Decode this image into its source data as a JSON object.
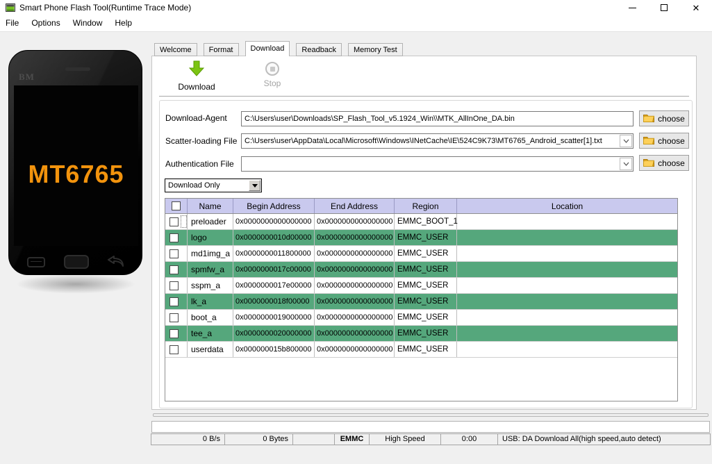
{
  "window": {
    "title": "Smart Phone Flash Tool(Runtime Trace Mode)"
  },
  "menu": {
    "items": [
      "File",
      "Options",
      "Window",
      "Help"
    ]
  },
  "phone": {
    "brand": "BM",
    "chipset": "MT6765"
  },
  "tabs": {
    "items": [
      "Welcome",
      "Format",
      "Download",
      "Readback",
      "Memory Test"
    ],
    "active": "Download"
  },
  "toolbar": {
    "download_label": "Download",
    "stop_label": "Stop"
  },
  "fields": {
    "download_agent": {
      "label": "Download-Agent",
      "value": "C:\\Users\\user\\Downloads\\SP_Flash_Tool_v5.1924_Win\\\\MTK_AllInOne_DA.bin",
      "choose_label": "choose"
    },
    "scatter_file": {
      "label": "Scatter-loading File",
      "value": "C:\\Users\\user\\AppData\\Local\\Microsoft\\Windows\\INetCache\\IE\\524C9K73\\MT6765_Android_scatter[1].txt",
      "choose_label": "choose"
    },
    "auth_file": {
      "label": "Authentication File",
      "value": "",
      "choose_label": "choose"
    }
  },
  "mode_select": {
    "value": "Download Only"
  },
  "table": {
    "headers": [
      "Name",
      "Begin Address",
      "End Address",
      "Region",
      "Location"
    ],
    "rows": [
      {
        "name": "preloader",
        "begin": "0x0000000000000000",
        "end": "0x0000000000000000",
        "region": "EMMC_BOOT_1",
        "location": "",
        "highlight": false,
        "checked": false
      },
      {
        "name": "logo",
        "begin": "0x0000000010d00000",
        "end": "0x0000000000000000",
        "region": "EMMC_USER",
        "location": "",
        "highlight": true,
        "checked": false
      },
      {
        "name": "md1img_a",
        "begin": "0x0000000011800000",
        "end": "0x0000000000000000",
        "region": "EMMC_USER",
        "location": "",
        "highlight": false,
        "checked": false
      },
      {
        "name": "spmfw_a",
        "begin": "0x0000000017c00000",
        "end": "0x0000000000000000",
        "region": "EMMC_USER",
        "location": "",
        "highlight": true,
        "checked": false
      },
      {
        "name": "sspm_a",
        "begin": "0x0000000017e00000",
        "end": "0x0000000000000000",
        "region": "EMMC_USER",
        "location": "",
        "highlight": false,
        "checked": false
      },
      {
        "name": "lk_a",
        "begin": "0x0000000018f00000",
        "end": "0x0000000000000000",
        "region": "EMMC_USER",
        "location": "",
        "highlight": true,
        "checked": false
      },
      {
        "name": "boot_a",
        "begin": "0x0000000019000000",
        "end": "0x0000000000000000",
        "region": "EMMC_USER",
        "location": "",
        "highlight": false,
        "checked": false
      },
      {
        "name": "tee_a",
        "begin": "0x0000000020000000",
        "end": "0x0000000000000000",
        "region": "EMMC_USER",
        "location": "",
        "highlight": true,
        "checked": false
      },
      {
        "name": "userdata",
        "begin": "0x000000015b800000",
        "end": "0x0000000000000000",
        "region": "EMMC_USER",
        "location": "",
        "highlight": false,
        "checked": false
      }
    ]
  },
  "status_bar": {
    "speed": "0 B/s",
    "bytes": "0 Bytes",
    "storage": "EMMC",
    "speed_mode": "High Speed",
    "time": "0:00",
    "usb": "USB: DA Download All(high speed,auto detect)"
  },
  "colors": {
    "row_highlight": "#55a77c",
    "table_header_bg": "#c9c9ee",
    "download_arrow_green": "#7cc413",
    "chipset_orange": "#f2930d"
  }
}
